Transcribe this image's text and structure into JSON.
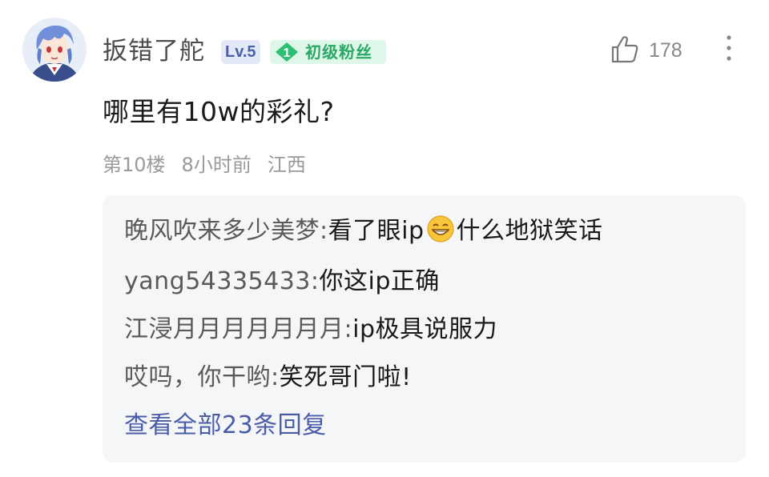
{
  "comment": {
    "username": "扳错了舵",
    "level_badge": "Lv.5",
    "fan_badge": {
      "level": "1",
      "label": "初级粉丝"
    },
    "likes": "178",
    "text": "哪里有10w的彩礼?",
    "floor": "第10楼",
    "time": "8小时前",
    "location": "江西"
  },
  "replies": [
    {
      "author": "晚风吹来多少美梦",
      "sep": ":",
      "before_emoji": "看了眼ip",
      "emoji": "grinning-face",
      "after_emoji": "什么地狱笑话"
    },
    {
      "author": "yang54335433",
      "sep": ":",
      "text": "你这ip正确"
    },
    {
      "author": "江浸月月月月月月月",
      "sep": ":",
      "text": "ip极具说服力"
    },
    {
      "author": "哎吗，你干哟",
      "sep": ":",
      "text": "笑死哥门啦!"
    }
  ],
  "view_all": "查看全部23条回复",
  "colors": {
    "background": "#ffffff",
    "reply_panel": "#f5f6f8",
    "link_blue": "#4b5ca6",
    "fan_green": "#2aa866",
    "level_blue": "#4a5fa8",
    "meta_gray": "#9a9a9a"
  },
  "icons": {
    "avatar": "anime-avatar",
    "like": "thumbs-up-icon",
    "more": "more-vertical-icon",
    "fan_gem": "gem-icon",
    "emoji": "grinning-face-emoji"
  }
}
